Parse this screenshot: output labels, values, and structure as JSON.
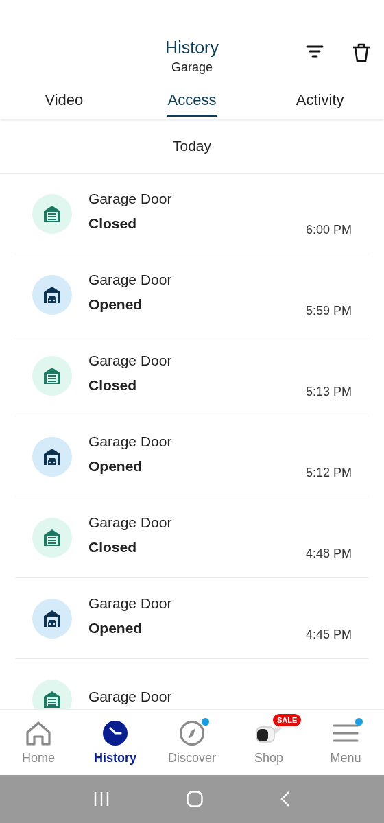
{
  "header": {
    "title": "History",
    "subtitle": "Garage"
  },
  "tabs": [
    {
      "label": "Video",
      "selected": false
    },
    {
      "label": "Access",
      "selected": true
    },
    {
      "label": "Activity",
      "selected": false
    }
  ],
  "section": "Today",
  "events": [
    {
      "kind": "closed",
      "name": "Garage Door",
      "status": "Closed",
      "time": "6:00 PM"
    },
    {
      "kind": "opened",
      "name": "Garage Door",
      "status": "Opened",
      "time": "5:59 PM"
    },
    {
      "kind": "closed",
      "name": "Garage Door",
      "status": "Closed",
      "time": "5:13 PM"
    },
    {
      "kind": "opened",
      "name": "Garage Door",
      "status": "Opened",
      "time": "5:12 PM"
    },
    {
      "kind": "closed",
      "name": "Garage Door",
      "status": "Closed",
      "time": "4:48 PM"
    },
    {
      "kind": "opened",
      "name": "Garage Door",
      "status": "Opened",
      "time": "4:45 PM"
    },
    {
      "kind": "closed",
      "name": "Garage Door"
    }
  ],
  "nav": [
    {
      "kind": "home",
      "label": "Home",
      "selected": false
    },
    {
      "kind": "history",
      "label": "History",
      "selected": true
    },
    {
      "kind": "discover",
      "label": "Discover",
      "selected": false,
      "dot": true
    },
    {
      "kind": "shop",
      "label": "Shop",
      "selected": false,
      "badge": "SALE"
    },
    {
      "kind": "menu",
      "label": "Menu",
      "selected": false,
      "dot": true
    }
  ]
}
